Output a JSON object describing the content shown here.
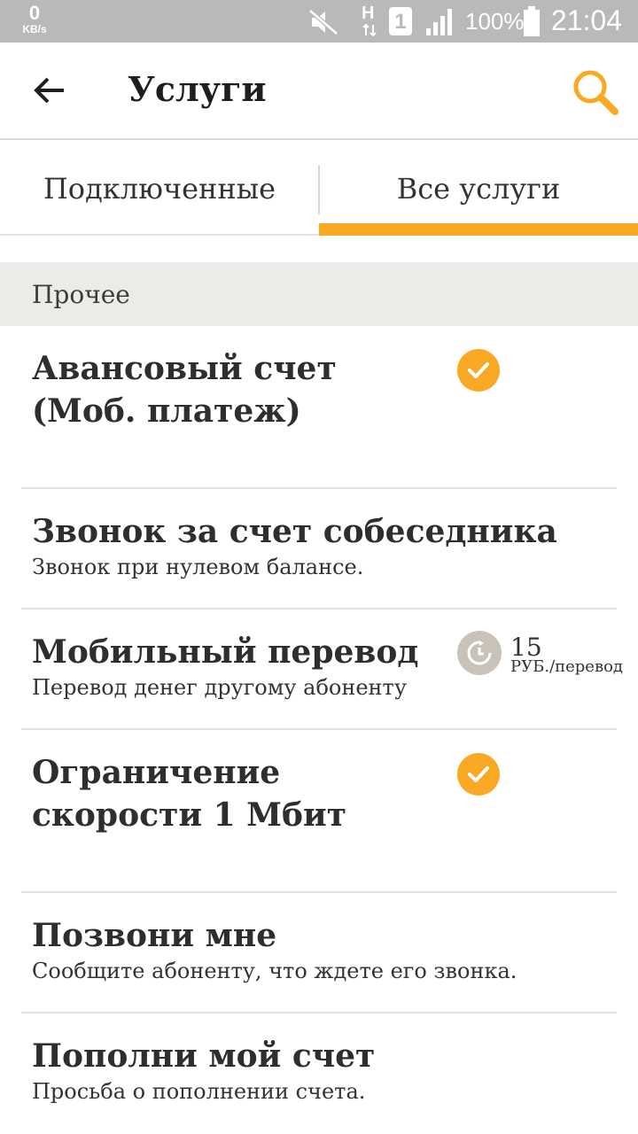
{
  "status_bar": {
    "speed_value": "0",
    "speed_unit": "KB/s",
    "network_type": "H",
    "sim_slot": "1",
    "battery": "100%",
    "time": "21:04",
    "icons": [
      "mute-icon",
      "signal-icon",
      "battery-icon"
    ]
  },
  "header": {
    "title": "Услуги",
    "back_icon": "arrow-left-icon",
    "search_icon": "search-icon",
    "accent_color": "#f9a923"
  },
  "tabs": [
    {
      "label": "Подключенные",
      "active": false
    },
    {
      "label": "Все услуги",
      "active": true
    }
  ],
  "section": {
    "title": "Прочее"
  },
  "items": [
    {
      "title": "Авансовый счет (Моб. платеж)",
      "subtitle": "",
      "status": "connected"
    },
    {
      "title": "Звонок за счет собеседника",
      "subtitle": "Звонок при нулевом балансе.",
      "status": "none"
    },
    {
      "title": "Мобильный перевод",
      "subtitle": "Перевод денег другому абоненту",
      "status": "paid",
      "price": "15",
      "price_unit": "РУБ./перевод"
    },
    {
      "title": "Ограничение скорости 1 Мбит",
      "subtitle": "",
      "status": "connected"
    },
    {
      "title": "Позвони мне",
      "subtitle": "Сообщите абоненту, что ждете его звонка.",
      "status": "none"
    },
    {
      "title": "Пополни мой счет",
      "subtitle": "Просьба о пополнении счета.",
      "status": "none"
    }
  ]
}
